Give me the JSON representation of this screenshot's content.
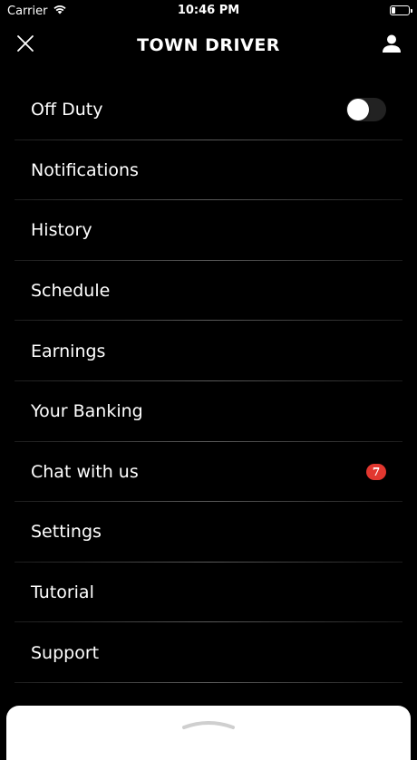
{
  "status_bar": {
    "carrier": "Carrier",
    "time": "10:46 PM",
    "battery_level": 0.25,
    "icons": [
      "wifi-icon",
      "battery-icon"
    ]
  },
  "header": {
    "title": "TOWN DRIVER",
    "close_icon": "close-icon",
    "profile_icon": "person-icon"
  },
  "menu": {
    "items": [
      {
        "label": "Off Duty",
        "toggle_on": false
      },
      {
        "label": "Notifications"
      },
      {
        "label": "History"
      },
      {
        "label": "Schedule"
      },
      {
        "label": "Earnings"
      },
      {
        "label": "Your Banking"
      },
      {
        "label": "Chat with us",
        "badge": "7"
      },
      {
        "label": "Settings"
      },
      {
        "label": "Tutorial"
      },
      {
        "label": "Support"
      }
    ]
  },
  "colors": {
    "background": "#000000",
    "text": "#ffffff",
    "badge": "#e2372f",
    "divider": "#5a5a5a",
    "sheet": "#ffffff"
  }
}
